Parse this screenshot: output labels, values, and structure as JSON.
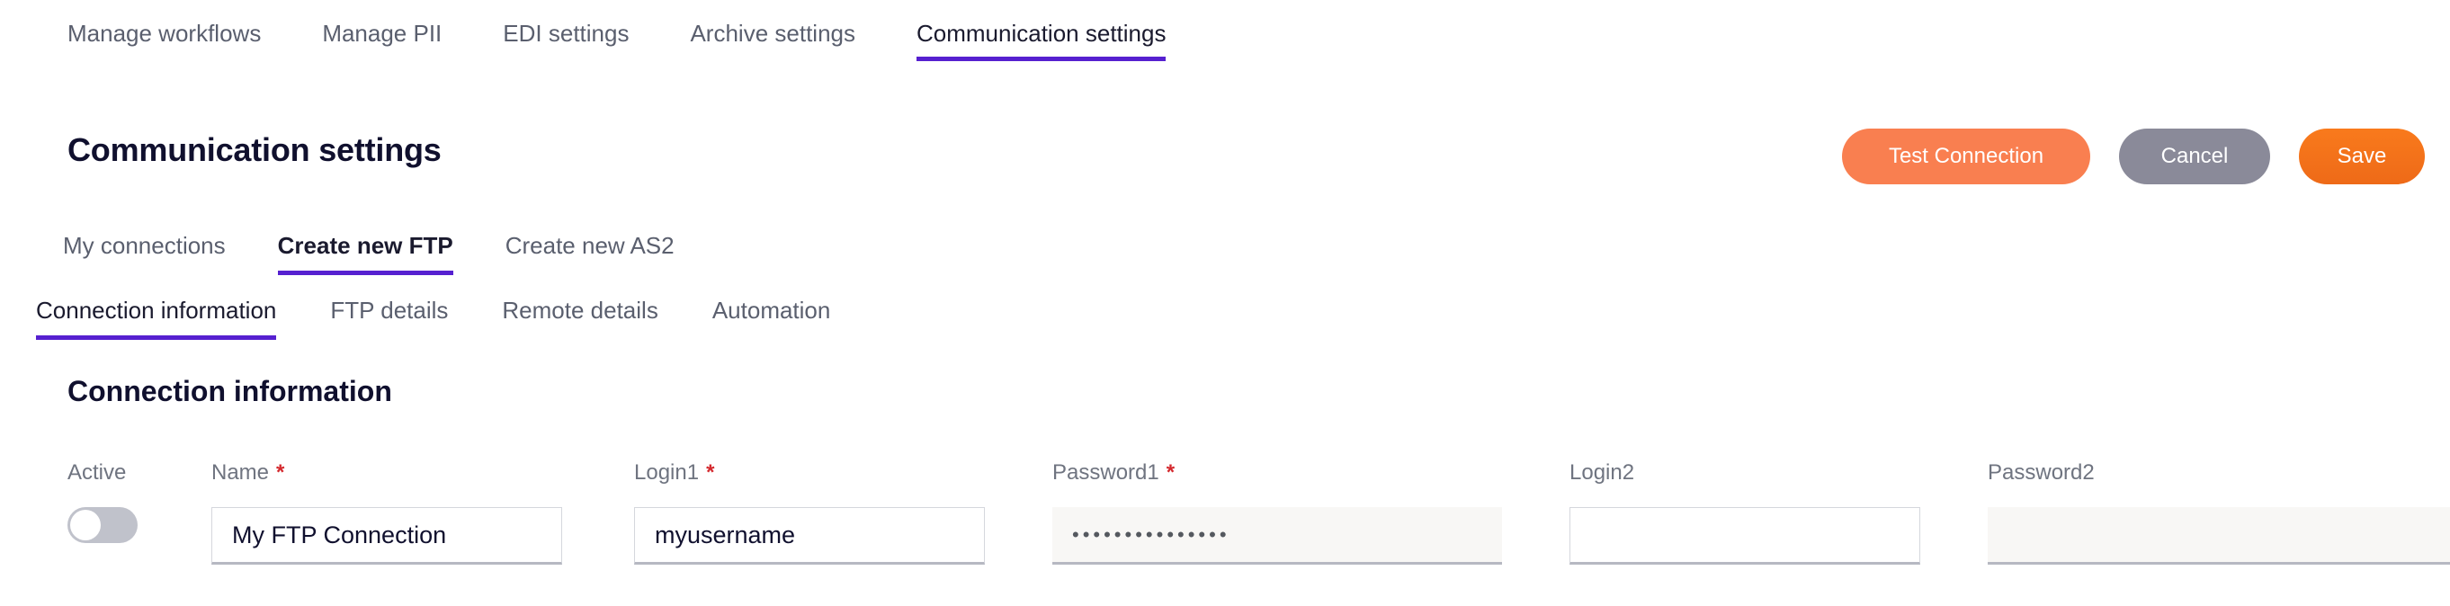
{
  "top_tabs": [
    {
      "label": "Manage workflows",
      "active": false
    },
    {
      "label": "Manage PII",
      "active": false
    },
    {
      "label": "EDI settings",
      "active": false
    },
    {
      "label": "Archive settings",
      "active": false
    },
    {
      "label": "Communication settings",
      "active": true
    }
  ],
  "header": {
    "title": "Communication settings"
  },
  "actions": {
    "test_connection": "Test Connection",
    "cancel": "Cancel",
    "save": "Save"
  },
  "sub_tabs": [
    {
      "label": "My connections",
      "active": false
    },
    {
      "label": "Create new FTP",
      "active": true
    },
    {
      "label": "Create new AS2",
      "active": false
    }
  ],
  "third_tabs": [
    {
      "label": "Connection information",
      "active": true
    },
    {
      "label": "FTP details",
      "active": false
    },
    {
      "label": "Remote details",
      "active": false
    },
    {
      "label": "Automation",
      "active": false
    }
  ],
  "section": {
    "title": "Connection information"
  },
  "form": {
    "active": {
      "label": "Active",
      "state": "off"
    },
    "name": {
      "label": "Name",
      "required": "*",
      "value": "My FTP Connection"
    },
    "login1": {
      "label": "Login1",
      "required": "*",
      "value": "myusername"
    },
    "password1": {
      "label": "Password1",
      "required": "*",
      "value": "•••••••••••••••"
    },
    "login2": {
      "label": "Login2",
      "value": ""
    },
    "password2": {
      "label": "Password2",
      "value": ""
    }
  },
  "colors": {
    "accent_purple": "#5620d0",
    "btn_test": "#f97f50",
    "btn_cancel": "#8a8a99",
    "btn_save": "#f27418",
    "required_red": "#d4282d",
    "title_navy": "#10102e",
    "label_gray": "#6f7480"
  }
}
